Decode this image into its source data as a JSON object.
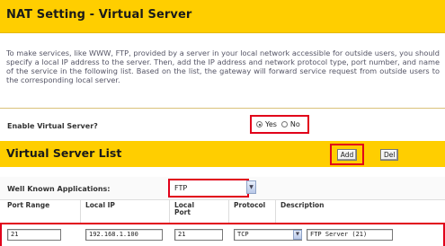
{
  "page": {
    "title": "NAT Setting - Virtual Server",
    "intro": "To make services, like WWW, FTP, provided by a server in your local network accessible for outside users, you should specify a local IP address to the server. Then, add the IP address and network protocol type, port number, and name of the service in the following list. Based on the list, the gateway will forward service request from outside users to the corresponding local server."
  },
  "enable": {
    "label": "Enable Virtual Server?",
    "yes_label": "Yes",
    "no_label": "No",
    "selected": "Yes"
  },
  "list": {
    "title": "Virtual Server List",
    "add_label": "Add",
    "del_label": "Del"
  },
  "well_known": {
    "label": "Well Known Applications:",
    "value": "FTP"
  },
  "columns": {
    "port_range": "Port Range",
    "local_ip": "Local IP",
    "local_port": "Local Port",
    "protocol": "Protocol",
    "description": "Description"
  },
  "row": {
    "port_range": "21",
    "local_ip": "192.168.1.100",
    "local_port": "21",
    "protocol": "TCP",
    "description": "FTP Server (21)"
  },
  "colors": {
    "header_bg": "#ffce00",
    "highlight": "#e1001a"
  }
}
